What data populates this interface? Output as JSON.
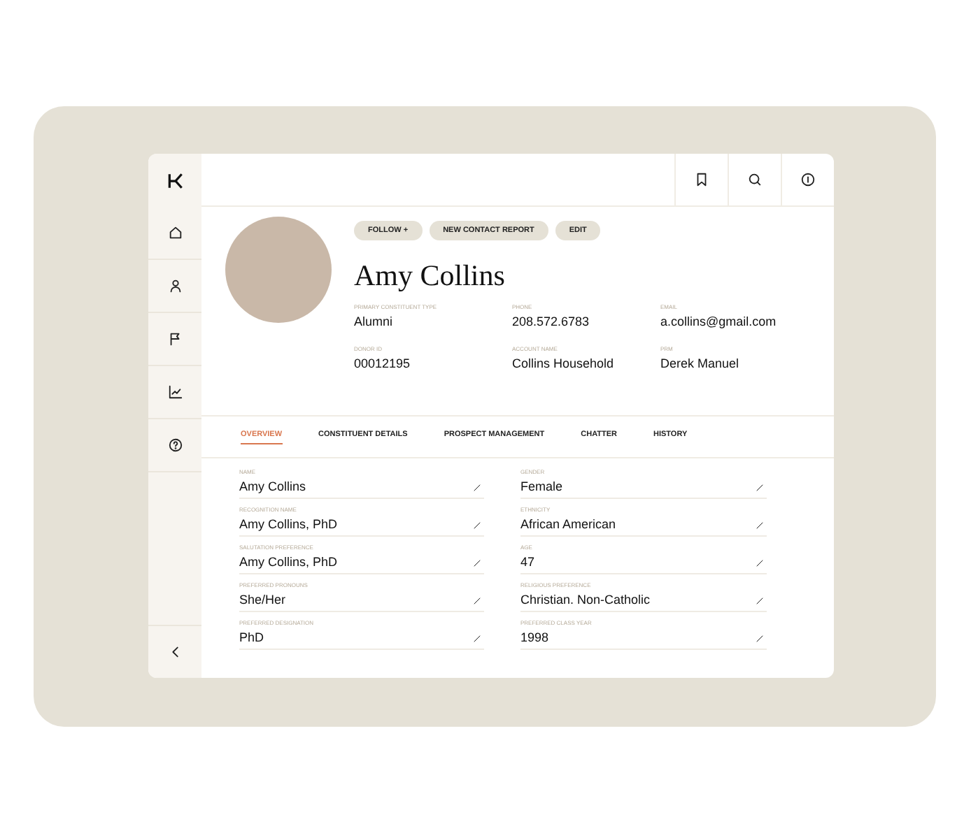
{
  "profile": {
    "name": "Amy Collins",
    "actions": [
      "FOLLOW +",
      "NEW CONTACT REPORT",
      "EDIT"
    ],
    "fields": [
      {
        "label": "PRIMARY CONSTITUENT TYPE",
        "value": "Alumni"
      },
      {
        "label": "PHONE",
        "value": "208.572.6783"
      },
      {
        "label": "EMAIL",
        "value": "a.collins@gmail.com"
      },
      {
        "label": "DONOR ID",
        "value": "00012195"
      },
      {
        "label": "ACCOUNT NAME",
        "value": "Collins Household"
      },
      {
        "label": "PRM",
        "value": "Derek Manuel"
      }
    ]
  },
  "tabs": [
    {
      "label": "OVERVIEW",
      "selected": true
    },
    {
      "label": "CONSTITUENT DETAILS",
      "selected": false
    },
    {
      "label": "PROSPECT MANAGEMENT",
      "selected": false
    },
    {
      "label": "CHATTER",
      "selected": false
    },
    {
      "label": "HISTORY",
      "selected": false
    }
  ],
  "details": [
    {
      "label": "NAME",
      "value": "Amy Collins"
    },
    {
      "label": "GENDER",
      "value": "Female"
    },
    {
      "label": "RECOGNITION NAME",
      "value": "Amy Collins, PhD"
    },
    {
      "label": "ETHNICITY",
      "value": "African American"
    },
    {
      "label": "SALUTATION PREFERENCE",
      "value": "Amy Collins, PhD"
    },
    {
      "label": "AGE",
      "value": "47"
    },
    {
      "label": "PREFERRED PRONOUNS",
      "value": "She/Her"
    },
    {
      "label": "RELIGIOUS PREFERENCE",
      "value": "Christian. Non-Catholic"
    },
    {
      "label": "PREFERRED DESIGNATION",
      "value": "PhD"
    },
    {
      "label": "PREFERRED CLASS YEAR",
      "value": "1998"
    }
  ]
}
